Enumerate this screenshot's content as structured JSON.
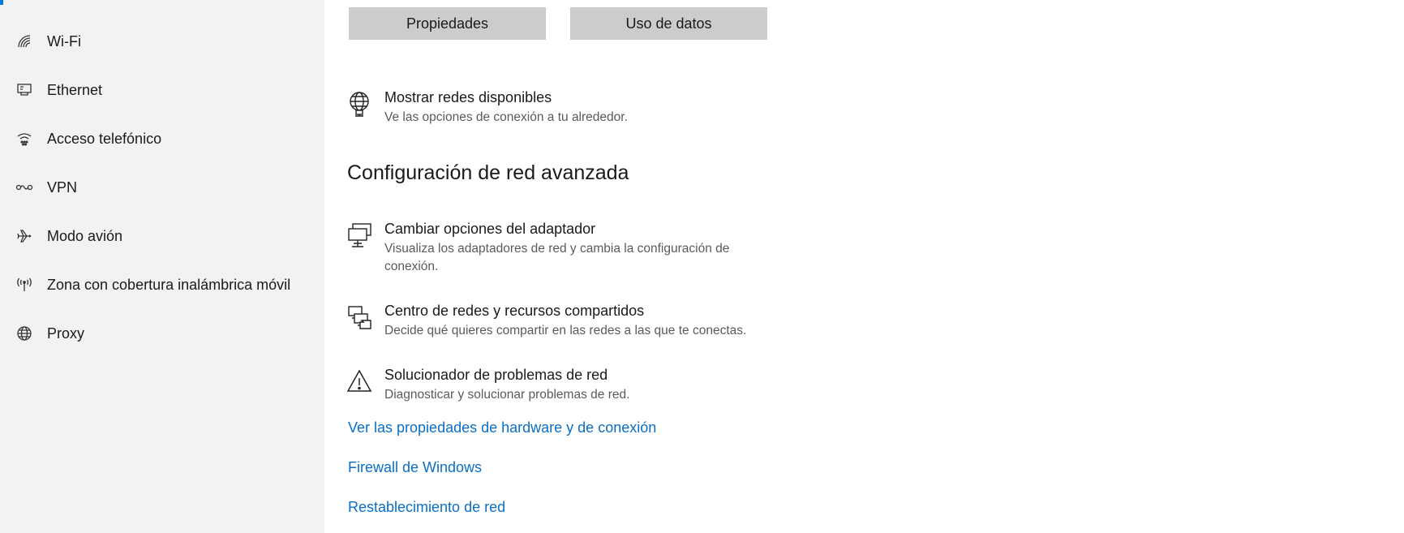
{
  "sidebar": {
    "items": [
      {
        "label": "Wi-Fi",
        "icon": "wifi-icon"
      },
      {
        "label": "Ethernet",
        "icon": "ethernet-icon"
      },
      {
        "label": "Acceso telefónico",
        "icon": "dialup-icon"
      },
      {
        "label": "VPN",
        "icon": "vpn-icon"
      },
      {
        "label": "Modo avión",
        "icon": "airplane-icon"
      },
      {
        "label": "Zona con cobertura inalámbrica móvil",
        "icon": "hotspot-icon"
      },
      {
        "label": "Proxy",
        "icon": "globe-icon"
      }
    ]
  },
  "main": {
    "buttons": {
      "properties": "Propiedades",
      "data_usage": "Uso de datos"
    },
    "show_networks": {
      "title": "Mostrar redes disponibles",
      "description": "Ve las opciones de conexión a tu alrededor.",
      "icon": "globe-network-icon"
    },
    "advanced_title": "Configuración de red avanzada",
    "options": [
      {
        "title": "Cambiar opciones del adaptador",
        "description": "Visualiza los adaptadores de red y cambia la configuración de conexión.",
        "icon": "network-adapter-icon"
      },
      {
        "title": "Centro de redes y recursos compartidos",
        "description": "Decide qué quieres compartir en las redes a las que te conectas.",
        "icon": "sharing-center-icon"
      },
      {
        "title": "Solucionador de problemas de red",
        "description": "Diagnosticar y solucionar problemas de red.",
        "icon": "warning-icon"
      }
    ],
    "links": [
      "Ver las propiedades de hardware y de conexión",
      "Firewall de Windows",
      "Restablecimiento de red"
    ]
  },
  "colors": {
    "accent": "#0078d7",
    "link": "#0a6fc4",
    "sidebar_bg": "#f2f2f2",
    "button_bg": "#cccccc"
  }
}
